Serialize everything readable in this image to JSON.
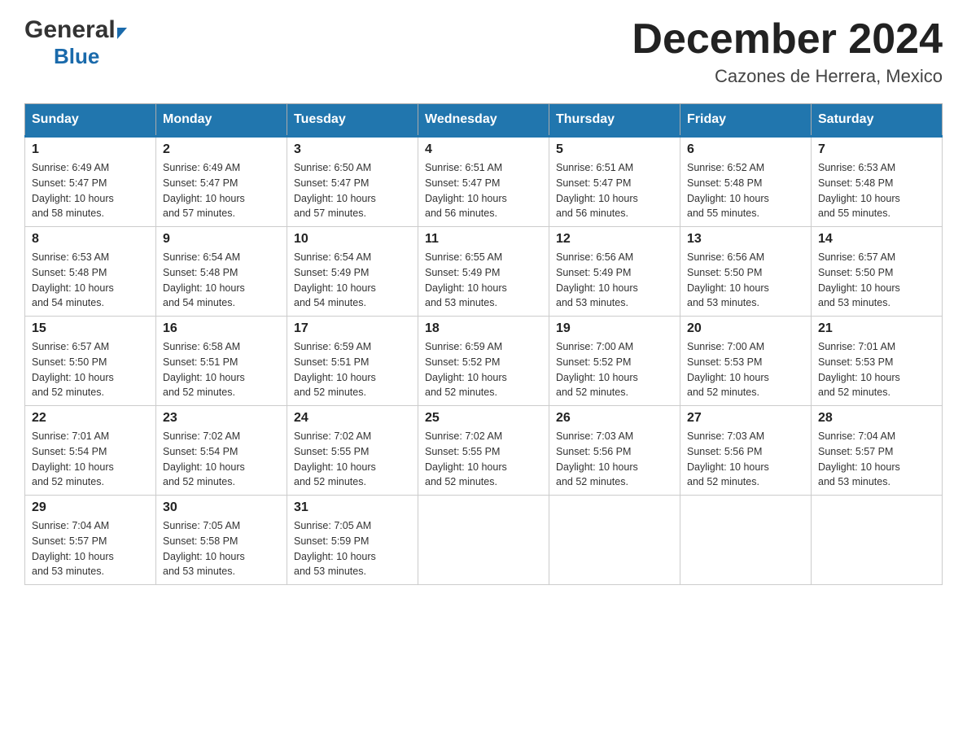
{
  "logo": {
    "general": "General",
    "blue": "Blue"
  },
  "title": "December 2024",
  "location": "Cazones de Herrera, Mexico",
  "days_of_week": [
    "Sunday",
    "Monday",
    "Tuesday",
    "Wednesday",
    "Thursday",
    "Friday",
    "Saturday"
  ],
  "weeks": [
    [
      {
        "day": "1",
        "sunrise": "6:49 AM",
        "sunset": "5:47 PM",
        "daylight": "10 hours and 58 minutes."
      },
      {
        "day": "2",
        "sunrise": "6:49 AM",
        "sunset": "5:47 PM",
        "daylight": "10 hours and 57 minutes."
      },
      {
        "day": "3",
        "sunrise": "6:50 AM",
        "sunset": "5:47 PM",
        "daylight": "10 hours and 57 minutes."
      },
      {
        "day": "4",
        "sunrise": "6:51 AM",
        "sunset": "5:47 PM",
        "daylight": "10 hours and 56 minutes."
      },
      {
        "day": "5",
        "sunrise": "6:51 AM",
        "sunset": "5:47 PM",
        "daylight": "10 hours and 56 minutes."
      },
      {
        "day": "6",
        "sunrise": "6:52 AM",
        "sunset": "5:48 PM",
        "daylight": "10 hours and 55 minutes."
      },
      {
        "day": "7",
        "sunrise": "6:53 AM",
        "sunset": "5:48 PM",
        "daylight": "10 hours and 55 minutes."
      }
    ],
    [
      {
        "day": "8",
        "sunrise": "6:53 AM",
        "sunset": "5:48 PM",
        "daylight": "10 hours and 54 minutes."
      },
      {
        "day": "9",
        "sunrise": "6:54 AM",
        "sunset": "5:48 PM",
        "daylight": "10 hours and 54 minutes."
      },
      {
        "day": "10",
        "sunrise": "6:54 AM",
        "sunset": "5:49 PM",
        "daylight": "10 hours and 54 minutes."
      },
      {
        "day": "11",
        "sunrise": "6:55 AM",
        "sunset": "5:49 PM",
        "daylight": "10 hours and 53 minutes."
      },
      {
        "day": "12",
        "sunrise": "6:56 AM",
        "sunset": "5:49 PM",
        "daylight": "10 hours and 53 minutes."
      },
      {
        "day": "13",
        "sunrise": "6:56 AM",
        "sunset": "5:50 PM",
        "daylight": "10 hours and 53 minutes."
      },
      {
        "day": "14",
        "sunrise": "6:57 AM",
        "sunset": "5:50 PM",
        "daylight": "10 hours and 53 minutes."
      }
    ],
    [
      {
        "day": "15",
        "sunrise": "6:57 AM",
        "sunset": "5:50 PM",
        "daylight": "10 hours and 52 minutes."
      },
      {
        "day": "16",
        "sunrise": "6:58 AM",
        "sunset": "5:51 PM",
        "daylight": "10 hours and 52 minutes."
      },
      {
        "day": "17",
        "sunrise": "6:59 AM",
        "sunset": "5:51 PM",
        "daylight": "10 hours and 52 minutes."
      },
      {
        "day": "18",
        "sunrise": "6:59 AM",
        "sunset": "5:52 PM",
        "daylight": "10 hours and 52 minutes."
      },
      {
        "day": "19",
        "sunrise": "7:00 AM",
        "sunset": "5:52 PM",
        "daylight": "10 hours and 52 minutes."
      },
      {
        "day": "20",
        "sunrise": "7:00 AM",
        "sunset": "5:53 PM",
        "daylight": "10 hours and 52 minutes."
      },
      {
        "day": "21",
        "sunrise": "7:01 AM",
        "sunset": "5:53 PM",
        "daylight": "10 hours and 52 minutes."
      }
    ],
    [
      {
        "day": "22",
        "sunrise": "7:01 AM",
        "sunset": "5:54 PM",
        "daylight": "10 hours and 52 minutes."
      },
      {
        "day": "23",
        "sunrise": "7:02 AM",
        "sunset": "5:54 PM",
        "daylight": "10 hours and 52 minutes."
      },
      {
        "day": "24",
        "sunrise": "7:02 AM",
        "sunset": "5:55 PM",
        "daylight": "10 hours and 52 minutes."
      },
      {
        "day": "25",
        "sunrise": "7:02 AM",
        "sunset": "5:55 PM",
        "daylight": "10 hours and 52 minutes."
      },
      {
        "day": "26",
        "sunrise": "7:03 AM",
        "sunset": "5:56 PM",
        "daylight": "10 hours and 52 minutes."
      },
      {
        "day": "27",
        "sunrise": "7:03 AM",
        "sunset": "5:56 PM",
        "daylight": "10 hours and 52 minutes."
      },
      {
        "day": "28",
        "sunrise": "7:04 AM",
        "sunset": "5:57 PM",
        "daylight": "10 hours and 53 minutes."
      }
    ],
    [
      {
        "day": "29",
        "sunrise": "7:04 AM",
        "sunset": "5:57 PM",
        "daylight": "10 hours and 53 minutes."
      },
      {
        "day": "30",
        "sunrise": "7:05 AM",
        "sunset": "5:58 PM",
        "daylight": "10 hours and 53 minutes."
      },
      {
        "day": "31",
        "sunrise": "7:05 AM",
        "sunset": "5:59 PM",
        "daylight": "10 hours and 53 minutes."
      },
      null,
      null,
      null,
      null
    ]
  ],
  "labels": {
    "sunrise": "Sunrise:",
    "sunset": "Sunset:",
    "daylight": "Daylight:"
  },
  "colors": {
    "header_bg": "#2176ae",
    "header_text": "#ffffff",
    "border": "#aaaaaa",
    "row_border_top": "#2176ae"
  }
}
